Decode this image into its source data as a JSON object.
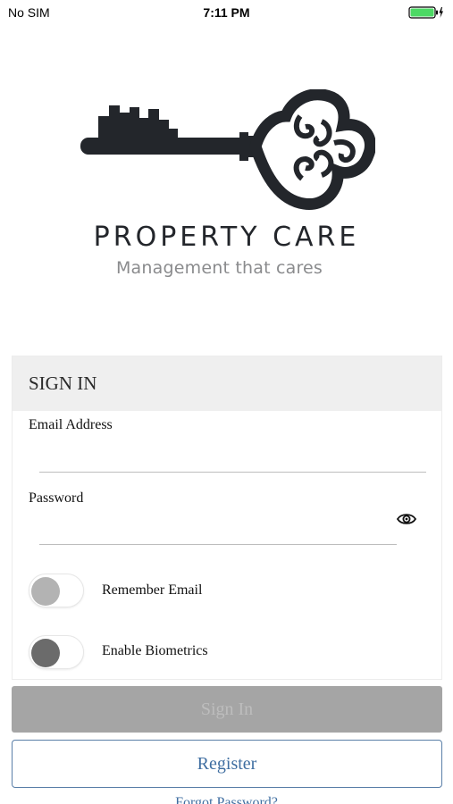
{
  "status_bar": {
    "carrier": "No SIM",
    "time": "7:11 PM",
    "battery_color": "#4cd964"
  },
  "brand": {
    "name": "PROPERTY CARE",
    "tagline": "Management that cares",
    "logo_icon": "key-city-icon",
    "logo_color": "#23262b"
  },
  "signin_card": {
    "title": "SIGN IN",
    "email": {
      "label": "Email Address",
      "value": "",
      "placeholder": ""
    },
    "password": {
      "label": "Password",
      "value": "",
      "placeholder": "",
      "toggle_icon": "eye-icon"
    },
    "remember_email": {
      "label": "Remember Email",
      "on": false,
      "knob_color": "#b3b3b3"
    },
    "enable_biometrics": {
      "label": "Enable Biometrics",
      "on": false,
      "knob_color": "#6b6b6b"
    }
  },
  "actions": {
    "signin_label": "Sign In",
    "register_label": "Register",
    "forgot_label": "Forgot Password?",
    "accent_color": "#3f6ea1"
  }
}
